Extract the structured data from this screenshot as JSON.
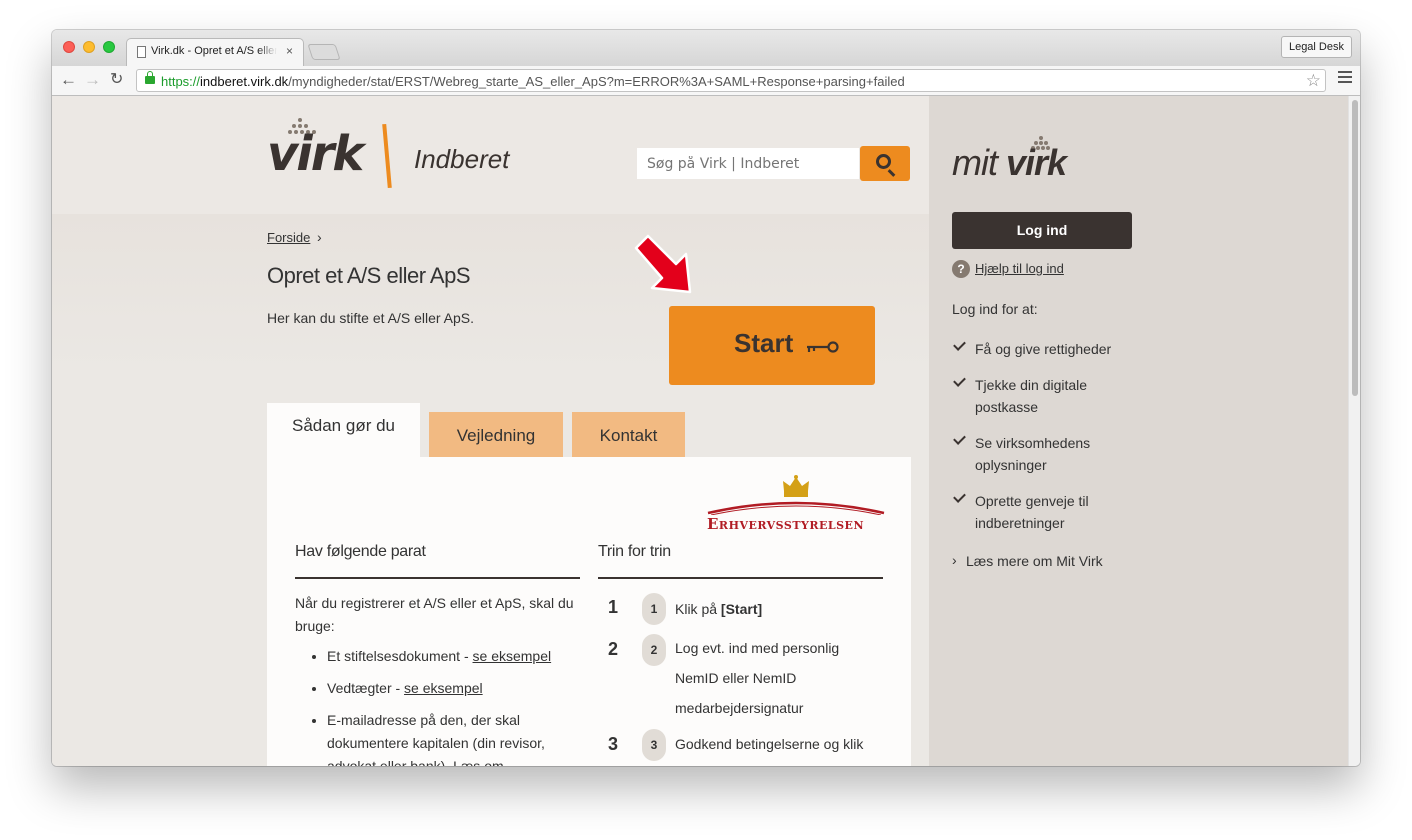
{
  "browser": {
    "tab_title": "Virk.dk - Opret et A/S eller ApS",
    "tab_close": "×",
    "extension_button": "Legal Desk",
    "url_scheme": "https://",
    "url_host": "indberet.virk.dk",
    "url_path": "/myndigheder/stat/ERST/Webreg_starte_AS_eller_ApS?m=ERROR%3A+SAML+Response+parsing+failed"
  },
  "header": {
    "logo_text": "virk",
    "logo_subtitle": "Indberet",
    "search_placeholder": "Søg på Virk | Indberet"
  },
  "breadcrumb": {
    "home": "Forside",
    "separator": "›"
  },
  "main": {
    "title": "Opret et A/S eller ApS",
    "intro": "Her kan du stifte et A/S eller ApS.",
    "start_label": "Start"
  },
  "tabs": [
    {
      "label": "Sådan gør du",
      "active": true
    },
    {
      "label": "Vejledning",
      "active": false
    },
    {
      "label": "Kontakt",
      "active": false
    }
  ],
  "panel": {
    "agency": "Erhvervsstyrelsen",
    "col1": {
      "heading": "Hav følgende parat",
      "intro": "Når du registrerer et A/S eller et ApS, skal du bruge:",
      "bullets": [
        {
          "text": "Et stiftelsesdokument - ",
          "link": "se eksempel"
        },
        {
          "text": "Vedtægter - ",
          "link": "se eksempel"
        },
        {
          "text": "E-mailadresse på den, der skal dokumentere kapitalen (din revisor, advokat eller bank). Læs om",
          "link": ""
        }
      ]
    },
    "col2": {
      "heading": "Trin for trin",
      "steps": [
        {
          "num": "1",
          "badge": "1",
          "prefix": "Klik på ",
          "bold": "[Start]",
          "text": ""
        },
        {
          "num": "2",
          "badge": "2",
          "prefix": "",
          "bold": "",
          "text": "Log evt. ind med personlig NemID eller NemID medarbejdersignatur"
        },
        {
          "num": "3",
          "badge": "3",
          "prefix": "",
          "bold": "",
          "text": "Godkend betingelserne og klik"
        }
      ]
    }
  },
  "sidebar": {
    "title_light": "mit",
    "title_bold": "virk",
    "login_label": "Log ind",
    "help_icon": "?",
    "help_link": "Hjælp til log ind",
    "login_for": "Log ind for at:",
    "benefits": [
      "Få og give rettigheder",
      "Tjekke din digitale postkasse",
      "Se virksomhedens oplysninger",
      "Oprette genveje til indberetninger"
    ],
    "read_more_chevron": "›",
    "read_more": "Læs mere om Mit Virk"
  },
  "colors": {
    "accent_orange": "#ed8b1f",
    "tab_orange": "#f2ba82",
    "dark_brown": "#3a3330",
    "agency_red": "#b11c24",
    "arrow_red": "#e3001b"
  }
}
